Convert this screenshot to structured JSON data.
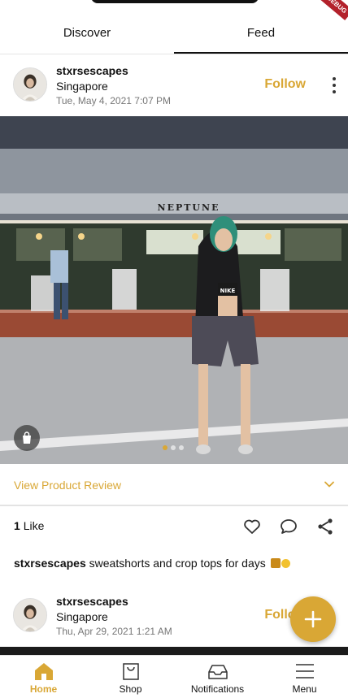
{
  "tabs": [
    {
      "label": "Discover",
      "active": false
    },
    {
      "label": "Feed",
      "active": true
    }
  ],
  "debug_banner": "DEBUG",
  "post1": {
    "username": "stxrsescapes",
    "location": "Singapore",
    "timestamp": "Tue, May 4, 2021 7:07 PM",
    "follow_label": "Follow",
    "photo_sign": "NEPTUNE",
    "shirt_text": "NIKE",
    "carousel_index": 1,
    "carousel_count": 3,
    "view_review_label": "View Product Review",
    "likes_count": "1",
    "likes_word": "Like",
    "caption_user": "stxrsescapes",
    "caption_text": "sweatshorts and crop tops for days"
  },
  "post2": {
    "username": "stxrsescapes",
    "location": "Singapore",
    "timestamp": "Thu, Apr 29, 2021 1:21 AM",
    "follow_label": "Follow"
  },
  "colors": {
    "accent": "#d9a735",
    "text": "#111111",
    "muted": "#777777"
  },
  "bottom_nav": [
    {
      "label": "Home",
      "icon": "home-icon",
      "active": true
    },
    {
      "label": "Shop",
      "icon": "shopping-bag-icon",
      "active": false
    },
    {
      "label": "Notifications",
      "icon": "inbox-icon",
      "active": false
    },
    {
      "label": "Menu",
      "icon": "menu-icon",
      "active": false
    }
  ]
}
